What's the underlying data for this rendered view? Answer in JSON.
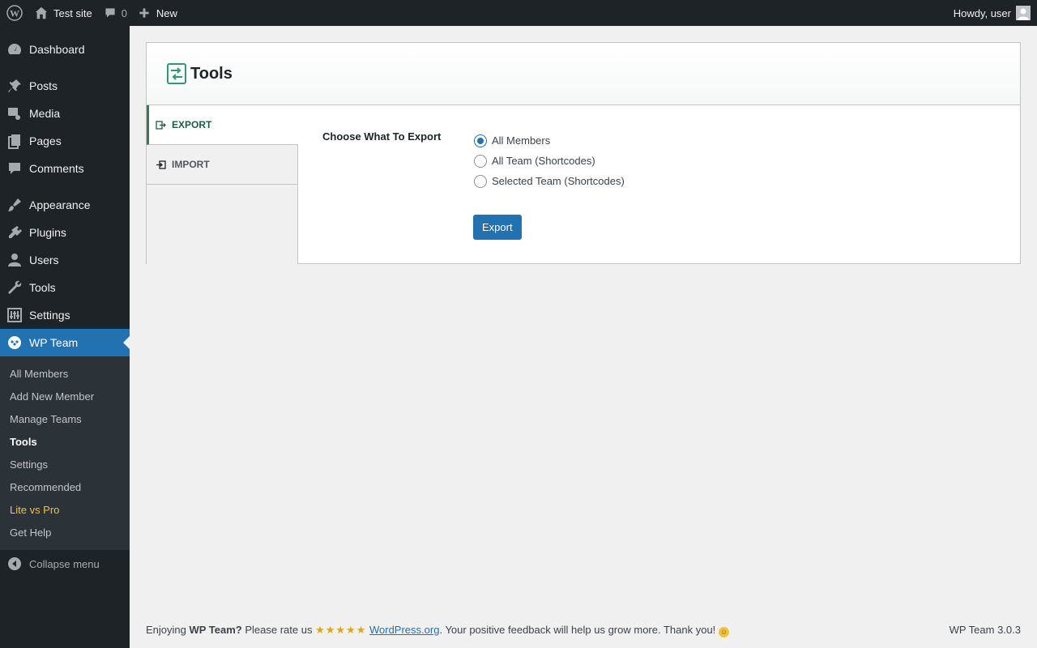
{
  "adminbar": {
    "site_name": "Test site",
    "comments_count": "0",
    "new_label": "New",
    "greeting": "Howdy, user"
  },
  "sidebar": {
    "items": [
      {
        "label": "Dashboard",
        "icon": "dashboard-icon"
      },
      {
        "label": "Posts",
        "icon": "pin-icon"
      },
      {
        "label": "Media",
        "icon": "media-icon"
      },
      {
        "label": "Pages",
        "icon": "pages-icon"
      },
      {
        "label": "Comments",
        "icon": "comment-icon"
      },
      {
        "label": "Appearance",
        "icon": "brush-icon"
      },
      {
        "label": "Plugins",
        "icon": "plugin-icon"
      },
      {
        "label": "Users",
        "icon": "user-icon"
      },
      {
        "label": "Tools",
        "icon": "wrench-icon"
      },
      {
        "label": "Settings",
        "icon": "settings-icon"
      },
      {
        "label": "WP Team",
        "icon": "team-icon"
      }
    ],
    "submenu": [
      "All Members",
      "Add New Member",
      "Manage Teams",
      "Tools",
      "Settings",
      "Recommended",
      "Lite vs Pro",
      "Get Help"
    ],
    "collapse_label": "Collapse menu"
  },
  "page": {
    "title": "Tools",
    "tabs": [
      {
        "label": "EXPORT"
      },
      {
        "label": "IMPORT"
      }
    ],
    "choose_label": "Choose What To Export",
    "options": [
      "All Members",
      "All Team (Shortcodes)",
      "Selected Team (Shortcodes)"
    ],
    "selected_option": "All Members",
    "export_button": "Export"
  },
  "footer": {
    "enjoying": "Enjoying ",
    "plugin_name": "WP Team?",
    "rate_text": " Please rate us ",
    "stars": "★★★★★",
    "link_text": "WordPress.org",
    "after_link": ". Your positive feedback will help us grow more. Thank you! ",
    "version": "WP Team 3.0.3"
  },
  "colors": {
    "accent": "#2271b1",
    "sidebar_bg": "#1d2327",
    "tab_active": "#2f7d5a",
    "highlight": "#f0c33c"
  }
}
